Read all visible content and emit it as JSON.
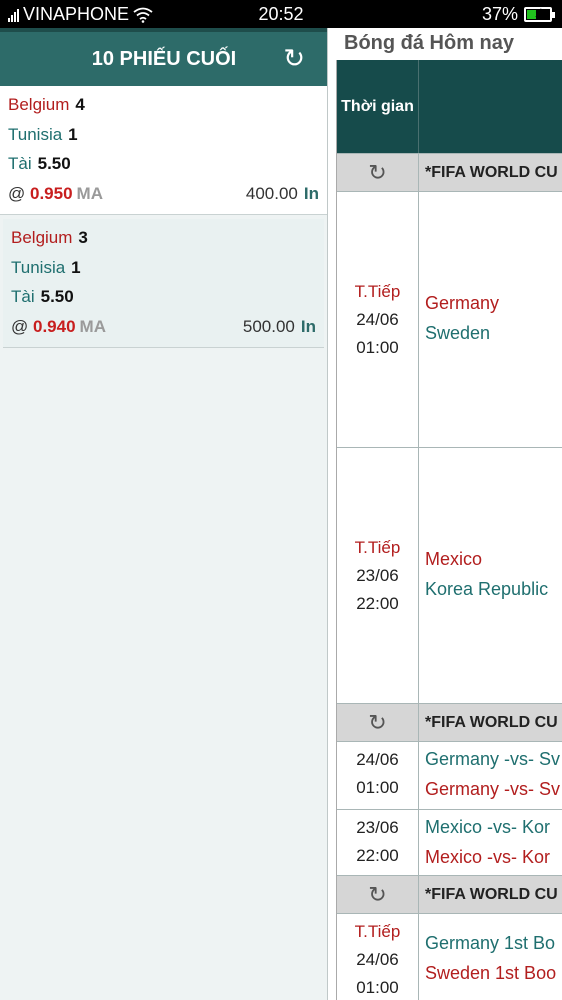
{
  "status_bar": {
    "carrier": "VINAPHONE",
    "time": "20:52",
    "battery": "37%"
  },
  "background": {
    "title": "Bóng đá   Hôm nay",
    "header_time": "Thời gian",
    "groups": [
      {
        "league": "*FIFA WORLD CU",
        "matches": [
          {
            "status": "T.Tiếp",
            "date": "24/06",
            "time": "01:00",
            "home": "Germany",
            "away": "Sweden"
          },
          {
            "status": "T.Tiếp",
            "date": "23/06",
            "time": "22:00",
            "home": "Mexico",
            "away": "Korea Republic"
          }
        ]
      },
      {
        "league": "*FIFA WORLD CU",
        "matches": [
          {
            "date": "24/06",
            "time": "01:00",
            "line1": "Germany -vs- Sv",
            "line2": "Germany -vs- Sv"
          },
          {
            "date": "23/06",
            "time": "22:00",
            "line1": "Mexico -vs- Kor",
            "line2": "Mexico -vs- Kor"
          }
        ]
      },
      {
        "league": "*FIFA WORLD CU",
        "matches": [
          {
            "status": "T.Tiếp",
            "date": "24/06",
            "time": "01:00",
            "line1": "Germany 1st Bo",
            "line2": "Sweden 1st Boo"
          }
        ]
      }
    ]
  },
  "panel": {
    "title": "10 PHIẾU CUỐI",
    "tickets": [
      {
        "team1": "Belgium",
        "score1": "4",
        "team2": "Tunisia",
        "score2": "1",
        "bet_type": "Tài",
        "bet_line": "5.50",
        "at": "@",
        "odds": "0.950",
        "market": "MA",
        "stake": "400.00",
        "status": "In"
      },
      {
        "team1": "Belgium",
        "score1": "3",
        "team2": "Tunisia",
        "score2": "1",
        "bet_type": "Tài",
        "bet_line": "5.50",
        "at": "@",
        "odds": "0.940",
        "market": "MA",
        "stake": "500.00",
        "status": "In"
      }
    ]
  }
}
